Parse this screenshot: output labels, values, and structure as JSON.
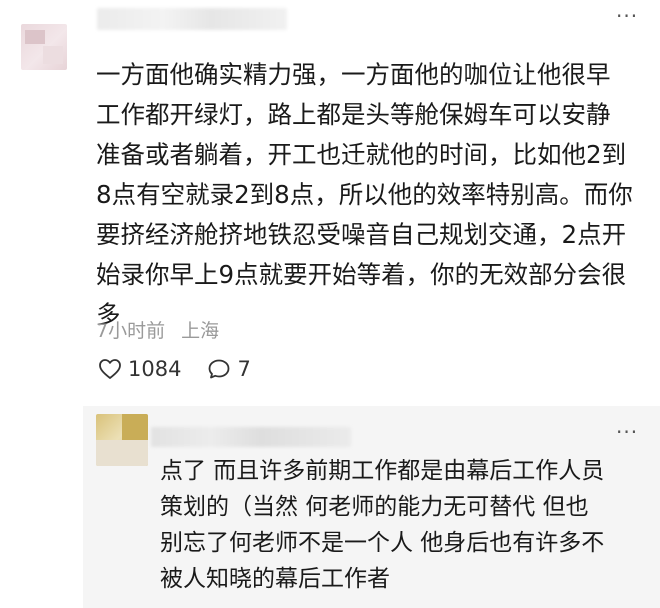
{
  "comment": {
    "more_icon": "more-horizontal-icon",
    "lines": [
      "一方面他确实精力强，一方面他的咖位让他很早",
      "工作都开绿灯，路上都是头等舱保姆车可以安静",
      "准备或者躺着，开工也迁就他的时间，比如他2到",
      "8点有空就录2到8点，所以他的效率特别高。而你",
      "要挤经济舱挤地铁忍受噪音自己规划交通，2点开",
      "始录你早上9点就要开始等着，你的无效部分会很",
      "多"
    ],
    "time": "7小时前",
    "location": "上海",
    "likes": "1084",
    "replies": "7",
    "like_icon": "heart-icon",
    "reply_icon": "comment-bubble-icon"
  },
  "reply": {
    "more_icon": "more-horizontal-icon",
    "lines": [
      "点了 而且许多前期工作都是由幕后工作人员",
      "策划的（当然 何老师的能力无可替代 但也",
      "别忘了何老师不是一个人 他身后也有许多不",
      "被人知晓的幕后工作者"
    ]
  },
  "colors": {
    "text": "#1a1a1a",
    "meta": "#9a9a9a",
    "reply_bg": "#f5f5f5"
  }
}
